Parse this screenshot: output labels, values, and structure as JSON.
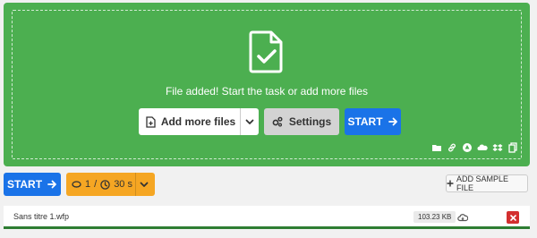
{
  "dropzone": {
    "message": "File added! Start the task or add more files",
    "add_more_label": "Add more files",
    "settings_label": "Settings",
    "start_label": "START",
    "tool_icons": [
      "folder-icon",
      "link-icon",
      "google-drive-icon",
      "onedrive-icon",
      "dropbox-icon",
      "copy-icon"
    ]
  },
  "toolbar": {
    "start_label": "START",
    "count": "1",
    "separator": "/",
    "timer": "30 s",
    "add_sample_label": "ADD SAMPLE FILE"
  },
  "files": [
    {
      "name": "Sans titre 1.wfp",
      "size": "103.23 KB"
    }
  ],
  "colors": {
    "dropzone_green": "#4caf50",
    "primary_blue": "#1a73e8",
    "counter_orange": "#f5a623",
    "delete_red": "#d32f2f"
  }
}
